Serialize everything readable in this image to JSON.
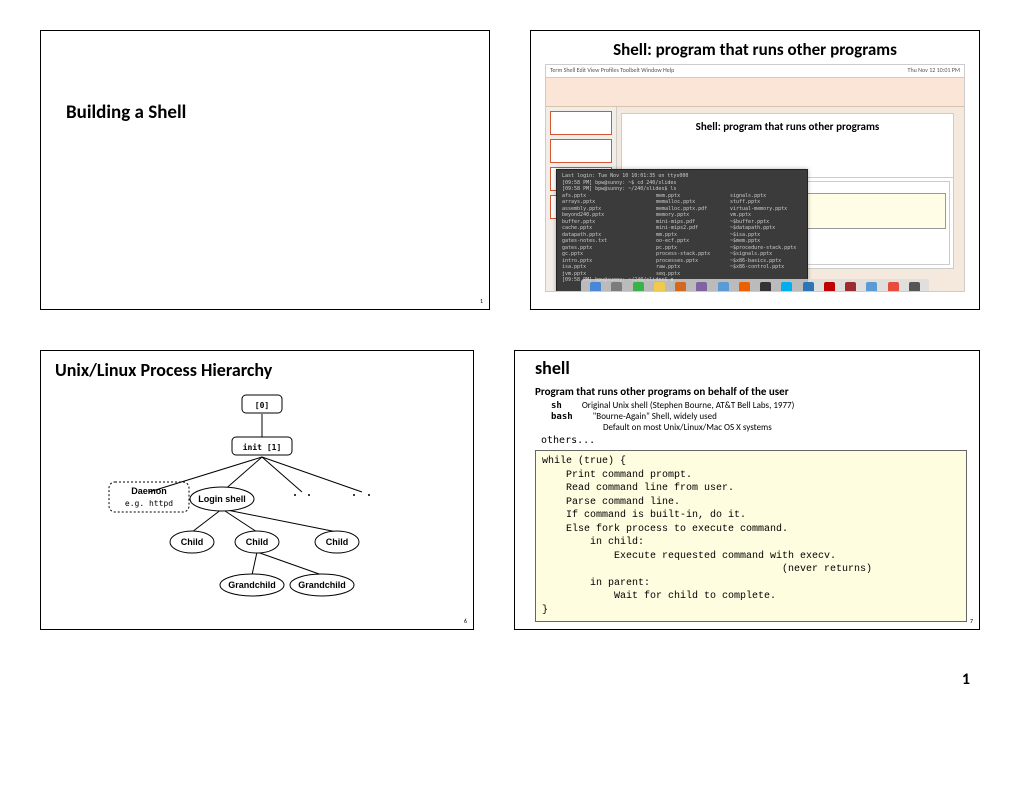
{
  "slide1": {
    "title": "Building a Shell",
    "num": "1"
  },
  "slide2": {
    "title": "Shell: program that runs other programs",
    "inner_title": "Shell: program that runs other programs",
    "menubar_left": "Term  Shell  Edit  View  Profiles  Toolbelt  Window  Help",
    "menubar_right": "Thu Nov 12 10:01 PM",
    "term_header": "Last login: Tue Nov 10 10:01:35 on ttys000\n[09:58 PM] bpw@sunny: ~$ cd 240/slides\n[09:58 PM] bpw@sunny: ~/240/slides$ ls",
    "term_col1": "afs.pptx\narrays.pptx\nassembly.pptx\nbeyond240.pptx\nbuffer.pptx\ncache.pptx\ndatapath.pptx\ngates-notes.txt\ngates.pptx\ngc.pptx\nintro.pptx\nisa.pptx\njvm.pptx",
    "term_col2": "mem.pptx\nmemalloc.pptx\nmemalloc.pptx.pdf\nmemory.pptx\nmini-mips.pdf\nmini-mips2.pdf\nmm.pptx\noo-ecf.pptx\npc.pptx\nprocess-stack.pptx\nprocesses.pptx\nraw.pptx\nseq.pptx",
    "term_col3": "signals.pptx\nstuff.pptx\nvirtual-memory.pptx\nvm.pptx\n~$buffer.pptx\n~$datapath.pptx\n~$isa.pptx\n~$mem.pptx\n~$procedure-stack.pptx\n~$signals.pptx\n~$x86-basics.pptx\n~$x86-control.pptx",
    "term_prompt": "[09:58 PM] bpw@sunny: ~/240/slides$ ▮"
  },
  "slide3": {
    "title": "Unix/Linux Process Hierarchy",
    "num": "6",
    "nodes": {
      "root": "[0]",
      "init": "init [1]",
      "daemon_title": "Daemon",
      "daemon_sub": "e.g. httpd",
      "login": "Login shell",
      "child1": "Child",
      "child2": "Child",
      "child3": "Child",
      "gc1": "Grandchild",
      "gc2": "Grandchild"
    }
  },
  "slide4": {
    "title": "shell",
    "num": "7",
    "subtitle": "Program that runs other programs on behalf of the user",
    "items": [
      {
        "term": "sh",
        "desc": "Original Unix shell (Stephen Bourne, AT&T Bell Labs, 1977)"
      },
      {
        "term": "bash",
        "desc": "\"Bourne-Again\" Shell, widely used"
      }
    ],
    "default_note": "Default on most Unix/Linux/Mac OS X systems",
    "others": "others...",
    "code": "while (true) {\n    Print command prompt.\n    Read command line from user.\n    Parse command line.\n    If command is built-in, do it.\n    Else fork process to execute command.\n        in child:\n            Execute requested command with execv.\n                                        (never returns)\n        in parent:\n            Wait for child to complete.\n}"
  },
  "page_number": "1"
}
